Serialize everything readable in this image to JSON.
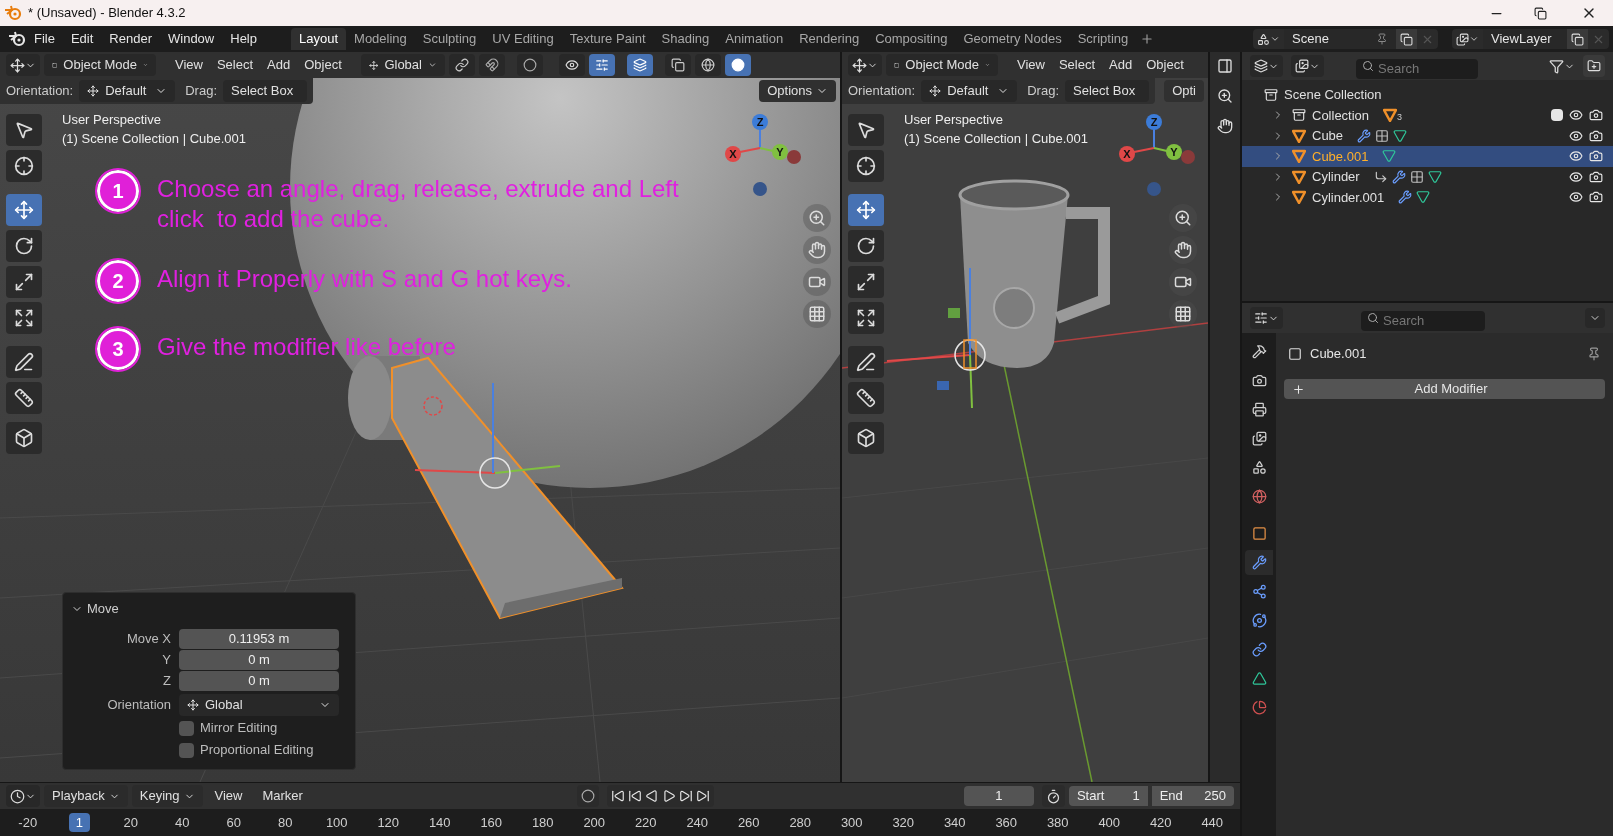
{
  "window": {
    "title": "* (Unsaved) - Blender 4.3.2"
  },
  "menu_bar": [
    "File",
    "Edit",
    "Render",
    "Window",
    "Help"
  ],
  "workspace_tabs": [
    {
      "label": "Layout",
      "selected": true
    },
    {
      "label": "Modeling",
      "selected": false
    },
    {
      "label": "Sculpting",
      "selected": false
    },
    {
      "label": "UV Editing",
      "selected": false
    },
    {
      "label": "Texture Paint",
      "selected": false
    },
    {
      "label": "Shading",
      "selected": false
    },
    {
      "label": "Animation",
      "selected": false
    },
    {
      "label": "Rendering",
      "selected": false
    },
    {
      "label": "Compositing",
      "selected": false
    },
    {
      "label": "Geometry Nodes",
      "selected": false
    },
    {
      "label": "Scripting",
      "selected": false
    }
  ],
  "scene": "Scene",
  "view_layer": "ViewLayer",
  "viewports": [
    {
      "mode": "Object Mode",
      "menus": [
        "View",
        "Select",
        "Add",
        "Object"
      ],
      "transform": "Global",
      "orientation_label": "Orientation:",
      "orientation": "Default",
      "drag_label": "Drag:",
      "drag": "Select Box",
      "options": "Options",
      "overlay_lines": [
        "User Perspective",
        "(1) Scene Collection | Cube.001"
      ],
      "gizmo": {
        "x": "X",
        "y": "Y",
        "z": "Z"
      },
      "tools": [
        {
          "kind": "select",
          "selected": false
        },
        {
          "kind": "cursor",
          "selected": false
        },
        {
          "kind": "move",
          "selected": true
        },
        {
          "kind": "rotate",
          "selected": false
        },
        {
          "kind": "scale",
          "selected": false
        },
        {
          "kind": "transform",
          "selected": false
        },
        {
          "kind": "annotate",
          "selected": false
        },
        {
          "kind": "measure",
          "selected": false
        },
        {
          "kind": "add-cube",
          "selected": false
        }
      ]
    },
    {
      "mode": "Object Mode",
      "menus": [
        "View",
        "Select",
        "Add",
        "Object"
      ],
      "orientation_label": "Orientation:",
      "orientation": "Default",
      "drag_label": "Drag:",
      "drag": "Select Box",
      "options": "Opti",
      "overlay_lines": [
        "User Perspective",
        "(1) Scene Collection | Cube.001"
      ],
      "gizmo": {
        "x": "X",
        "y": "Y",
        "z": "Z"
      },
      "tools": [
        {
          "kind": "select",
          "selected": false
        },
        {
          "kind": "cursor",
          "selected": false
        },
        {
          "kind": "move",
          "selected": true
        },
        {
          "kind": "rotate",
          "selected": false
        },
        {
          "kind": "scale",
          "selected": false
        },
        {
          "kind": "transform",
          "selected": false
        },
        {
          "kind": "annotate",
          "selected": false
        },
        {
          "kind": "measure",
          "selected": false
        },
        {
          "kind": "add-cube",
          "selected": false
        }
      ]
    }
  ],
  "steps": [
    {
      "number": "1",
      "text": "Choose an angle, drag, release, extrude and Left click  to add the cube."
    },
    {
      "number": "2",
      "text": "Align it Properly with S and G hot keys."
    },
    {
      "number": "3",
      "text": "Give the modifier like before"
    }
  ],
  "move_panel": {
    "title": "Move",
    "expanded": true,
    "fields": [
      {
        "label": "Move X",
        "value": "0.11953 m"
      },
      {
        "label": "Y",
        "value": "0 m"
      },
      {
        "label": "Z",
        "value": "0 m"
      }
    ],
    "orientation_label": "Orientation",
    "orientation": "Global",
    "checkboxes": [
      {
        "label": "Mirror Editing",
        "checked": false
      },
      {
        "label": "Proportional Editing",
        "checked": false
      }
    ]
  },
  "outliner": {
    "search_placeholder": "Search",
    "root": "Scene Collection",
    "items": [
      {
        "name": "Collection",
        "kind": "collection",
        "count": "3",
        "checked": true,
        "expanded": false,
        "selected": false
      },
      {
        "name": "Cube",
        "kind": "object",
        "expanded": false,
        "selected": false,
        "data_icons": [
          {
            "kind": "modifier"
          },
          {
            "kind": "nodes"
          },
          {
            "kind": "mesh"
          }
        ]
      },
      {
        "name": "Cube.001",
        "kind": "object",
        "expanded": false,
        "selected": true,
        "data_icons": [
          {
            "kind": "mesh"
          }
        ]
      },
      {
        "name": "Cylinder",
        "kind": "object",
        "expanded": false,
        "selected": false,
        "data_icons": [
          {
            "kind": "constraint"
          },
          {
            "kind": "modifier"
          },
          {
            "kind": "nodes"
          },
          {
            "kind": "mesh"
          }
        ]
      },
      {
        "name": "Cylinder.001",
        "kind": "object",
        "expanded": false,
        "selected": false,
        "data_icons": [
          {
            "kind": "modifier"
          },
          {
            "kind": "mesh"
          }
        ]
      }
    ]
  },
  "properties": {
    "search_placeholder": "Search",
    "object_name": "Cube.001",
    "add_button": "Add Modifier",
    "tabs": [
      {
        "kind": "tool",
        "selected": false
      },
      {
        "kind": "render",
        "selected": false
      },
      {
        "kind": "output",
        "selected": false
      },
      {
        "kind": "view-layer",
        "selected": false
      },
      {
        "kind": "scene",
        "selected": false
      },
      {
        "kind": "world",
        "selected": false
      },
      {
        "kind": "object",
        "selected": false
      },
      {
        "kind": "modifiers",
        "selected": true
      },
      {
        "kind": "particles",
        "selected": false
      },
      {
        "kind": "physics",
        "selected": false
      },
      {
        "kind": "constraints",
        "selected": false
      },
      {
        "kind": "data",
        "selected": false
      },
      {
        "kind": "material",
        "selected": false
      }
    ]
  },
  "timeline": {
    "menus": [
      "Playback",
      "Keying",
      "View",
      "Marker"
    ],
    "frame": "1",
    "start_label": "Start",
    "start": "1",
    "end_label": "End",
    "end": "250",
    "ruler": [
      {
        "label": "-20",
        "selected": false
      },
      {
        "label": "1",
        "selected": true
      },
      {
        "label": "20",
        "selected": false
      },
      {
        "label": "40",
        "selected": false
      },
      {
        "label": "60",
        "selected": false
      },
      {
        "label": "80",
        "selected": false
      },
      {
        "label": "100",
        "selected": false
      },
      {
        "label": "120",
        "selected": false
      },
      {
        "label": "140",
        "selected": false
      },
      {
        "label": "160",
        "selected": false
      },
      {
        "label": "180",
        "selected": false
      },
      {
        "label": "200",
        "selected": false
      },
      {
        "label": "220",
        "selected": false
      },
      {
        "label": "240",
        "selected": false
      },
      {
        "label": "260",
        "selected": false
      },
      {
        "label": "280",
        "selected": false
      },
      {
        "label": "300",
        "selected": false
      },
      {
        "label": "320",
        "selected": false
      },
      {
        "label": "340",
        "selected": false
      },
      {
        "label": "360",
        "selected": false
      },
      {
        "label": "380",
        "selected": false
      },
      {
        "label": "400",
        "selected": false
      },
      {
        "label": "420",
        "selected": false
      },
      {
        "label": "440",
        "selected": false
      }
    ]
  }
}
